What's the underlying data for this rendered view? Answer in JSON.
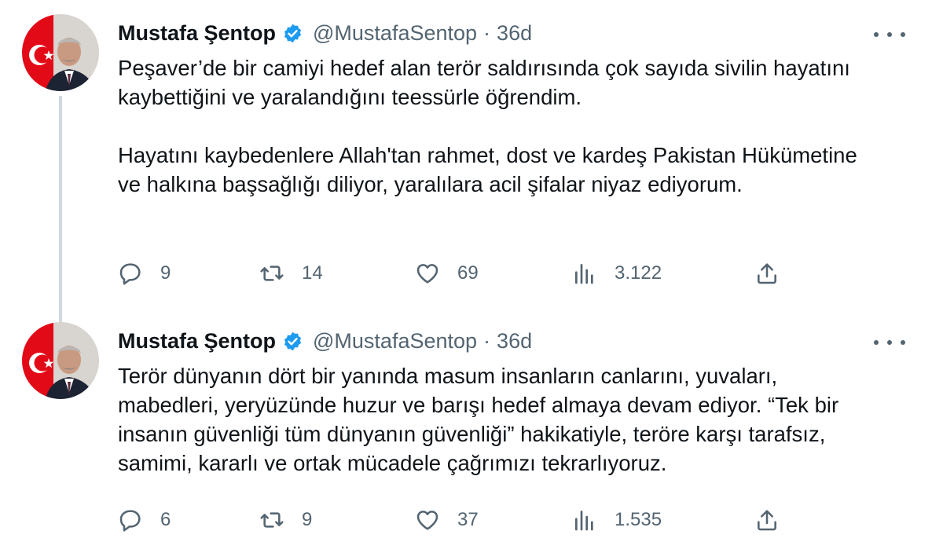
{
  "tweets": [
    {
      "author": "Mustafa Şentop",
      "handle": "@MustafaSentop",
      "separator": "·",
      "time": "36d",
      "paragraphs": [
        "Peşaver’de bir camiyi hedef alan terör saldırısında çok sayıda sivilin hayatını kaybettiğini ve yaralandığını teessürle öğrendim.",
        "Hayatını kaybedenlere Allah'tan rahmet, dost ve kardeş Pakistan Hükümetine ve halkına başsağlığı diliyor, yaralılara acil şifalar niyaz ediyorum."
      ],
      "stats": {
        "replies": "9",
        "retweets": "14",
        "likes": "69",
        "views": "3.122"
      }
    },
    {
      "author": "Mustafa Şentop",
      "handle": "@MustafaSentop",
      "separator": "·",
      "time": "36d",
      "paragraphs": [
        "Terör dünyanın dört bir yanında masum insanların canlarını, yuvaları, mabedleri, yeryüzünde huzur ve barışı hedef almaya devam ediyor. “Tek bir insanın güvenliği tüm dünyanın güvenliği” hakikatiyle, teröre karşı tarafsız, samimi, kararlı ve ortak mücadele çağrımızı tekrarlıyoruz."
      ],
      "stats": {
        "replies": "6",
        "retweets": "9",
        "likes": "37",
        "views": "1.535"
      }
    }
  ],
  "icons": {
    "verified": "verified-badge-icon",
    "more": "more-options-icon",
    "reply": "reply-icon",
    "retweet": "retweet-icon",
    "like": "heart-icon",
    "views": "views-chart-icon",
    "share": "share-icon"
  },
  "colors": {
    "text": "#0f1419",
    "secondary": "#536471",
    "verified": "#1d9bf0",
    "thread_line": "#cfd9de",
    "flag_red": "#e30a17"
  }
}
